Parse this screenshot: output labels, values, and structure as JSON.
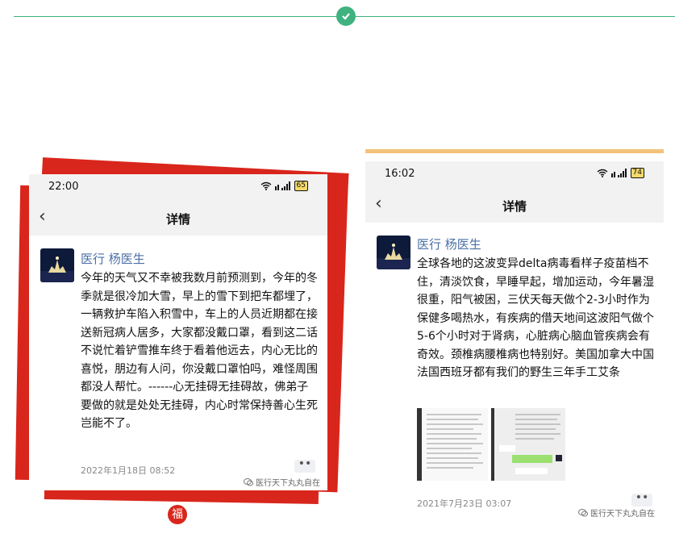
{
  "left_post": {
    "time": "22:00",
    "battery": "65",
    "nav_title": "详情",
    "author": "医行 杨医生",
    "text": "今年的天气又不幸被我数月前预测到，今年的冬季就是很冷加大雪，早上的雪下到把车都埋了，一辆救护车陷入积雪中，车上的人员近期都在接送新冠病人居多，大家都没戴口罩，看到这二话不说忙着铲雪推车终于看着他远去，内心无比的喜悦，朋边有人问，你没戴口罩怕吗，难怪周围都没人帮忙。------心无挂碍无挂碍故，佛弟子要做的就是处处无挂碍，内心时常保持善心生死岂能不了。",
    "date": "2022年1月18日 08:52",
    "watermark": "医行天下丸丸自在"
  },
  "right_post": {
    "time": "16:02",
    "battery": "74",
    "nav_title": "详情",
    "author": "医行 杨医生",
    "text": "全球各地的这波变异delta病毒看样子疫苗档不住，清淡饮食，早睡早起，增加运动，今年暑湿很重，阳气被困，三伏天每天做个2-3小时作为保健多喝热水，有疾病的借天地间这波阳气做个5-6个小时对于肾病，心脏病心脑血管疾病会有奇效。颈椎病腰椎病也特别好。美国加拿大中国法国西班牙都有我们的野生三年手工艾条",
    "date": "2021年7月23日 03:07",
    "watermark": "医行天下丸丸自在"
  },
  "seal_char": "福",
  "colors": {
    "accent_green": "#3fb27f",
    "red": "#d9261c",
    "orange": "#f3c27a",
    "author_blue": "#4a6fa5"
  },
  "icons": [
    "check-icon",
    "wifi-icon",
    "signal-icon",
    "battery-icon",
    "back-arrow-icon",
    "more-dots-icon",
    "wechat-icon",
    "seal-icon"
  ]
}
